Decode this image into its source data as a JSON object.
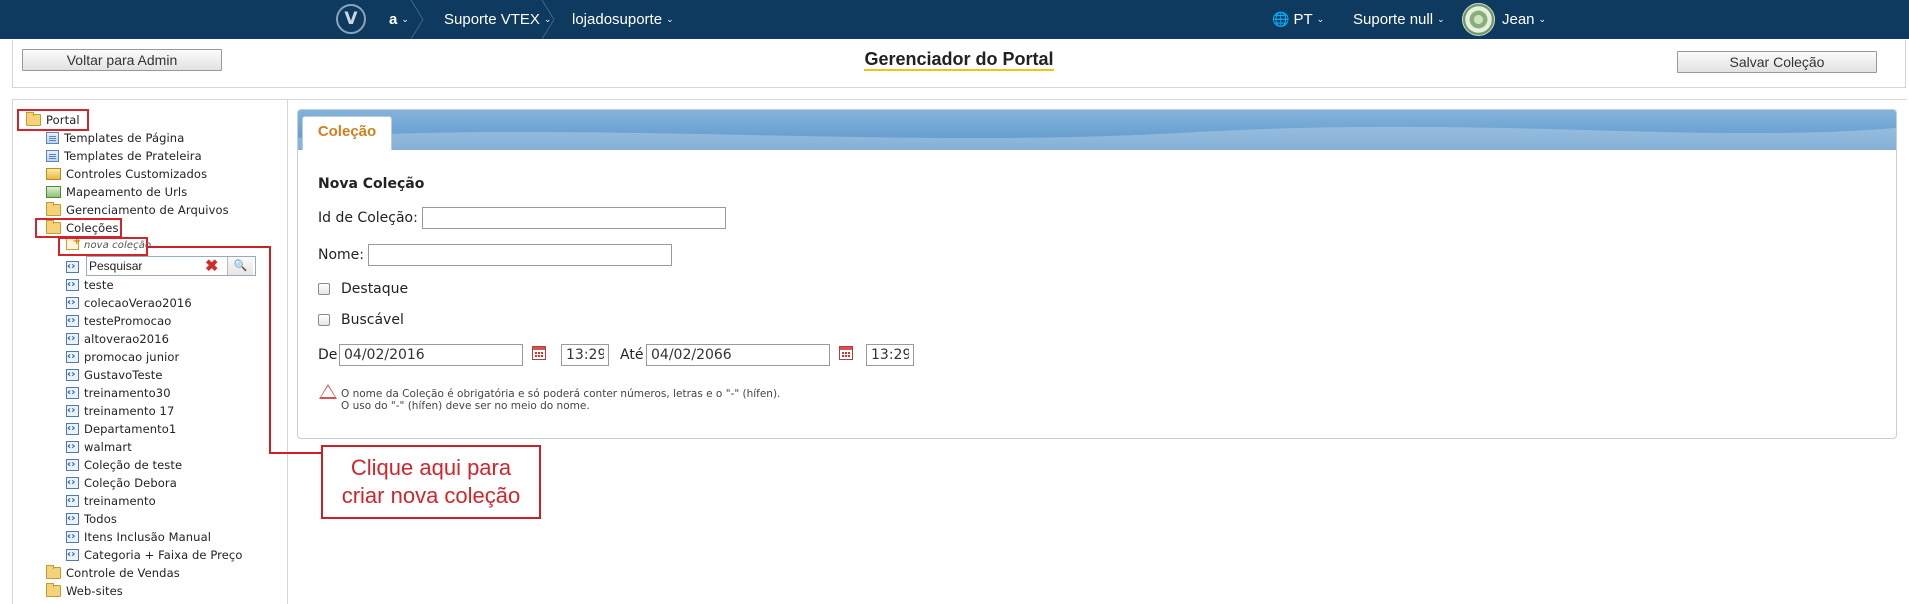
{
  "topbar": {
    "logo": "V",
    "account": "a",
    "store": "Suporte VTEX",
    "workspace": "lojadosuporte",
    "language": "PT",
    "support_menu": "Suporte null",
    "user": "Jean",
    "colors": {
      "background": "#0e3a5f"
    }
  },
  "header": {
    "back_button": "Voltar para Admin",
    "title": "Gerenciador do Portal",
    "save_button": "Salvar Coleção"
  },
  "tree": {
    "root": "Portal",
    "items": [
      {
        "label": "Templates de Página",
        "icon": "page-template-icon"
      },
      {
        "label": "Templates de Prateleira",
        "icon": "shelf-template-icon"
      },
      {
        "label": "Controles Customizados",
        "icon": "custom-control-icon"
      },
      {
        "label": "Mapeamento de Urls",
        "icon": "url-mapping-icon"
      },
      {
        "label": "Gerenciamento de Arquivos",
        "icon": "folder-icon"
      },
      {
        "label": "Coleções",
        "icon": "folder-open-icon"
      }
    ],
    "new_collection": "nova coleção",
    "search_value": "Pesquisar",
    "collections": [
      "teste",
      "colecaoVerao2016",
      "testePromocao",
      "altoverao2016",
      "promocao junior",
      "GustavoTeste",
      "treinamento30",
      "treinamento 17",
      "Departamento1",
      "walmart",
      "Coleção de teste",
      "Coleção Debora",
      "treinamento",
      "Todos",
      "Itens Inclusão Manual",
      "Categoria + Faixa de Preço"
    ],
    "after": [
      "Controle de Vendas",
      "Web-sites"
    ]
  },
  "panel": {
    "tab": "Coleção",
    "form_title": "Nova Coleção",
    "id_label": "Id de Coleção:",
    "id_value": "",
    "name_label": "Nome:",
    "name_value": "",
    "destaque_label": "Destaque",
    "buscavel_label": "Buscável",
    "from_label": "De",
    "from_date": "04/02/2016",
    "from_time": "13:29",
    "to_label": "Até",
    "to_date": "04/02/2066",
    "to_time": "13:29",
    "note_line1": "O nome da Coleção é obrigatória e só poderá conter números, letras e o \"-\" (hífen).",
    "note_line2": "O uso do \"-\" (hífen) deve ser no meio do nome."
  },
  "callout": {
    "line1": "Clique aqui para",
    "line2": "criar nova coleção",
    "color": "#cc2027"
  }
}
